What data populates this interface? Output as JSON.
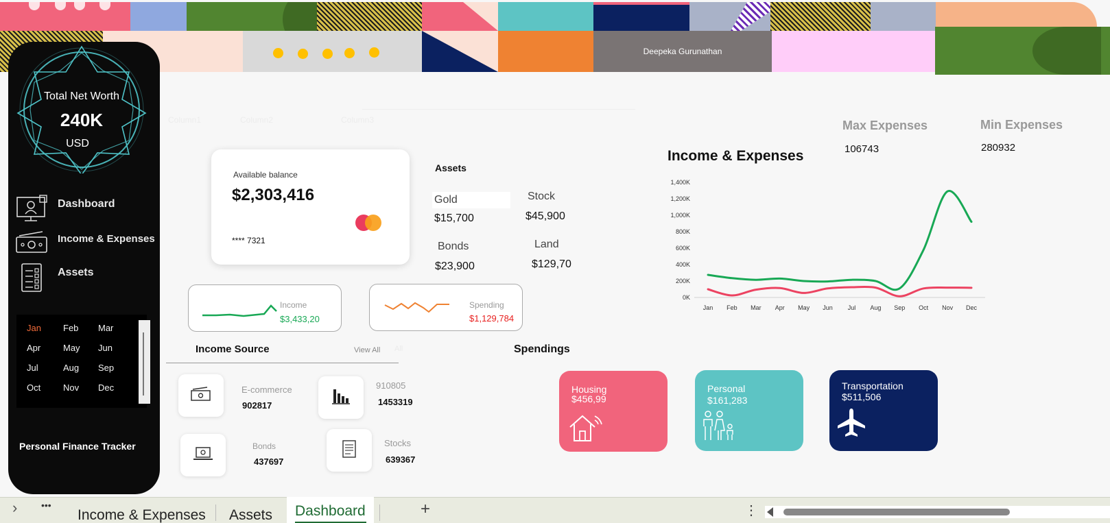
{
  "header": {
    "owner_name": "Deepeka Gurunathan"
  },
  "sidebar": {
    "networth": {
      "title": "Total Net Worth",
      "value": "240K",
      "unit": "USD"
    },
    "nav": [
      {
        "label": "Dashboard",
        "icon": "dashboard-monitor-icon"
      },
      {
        "label": "Income & Expenses",
        "icon": "cash-icon"
      },
      {
        "label": "Assets",
        "icon": "checklist-icon"
      }
    ],
    "months": [
      "Jan",
      "Feb",
      "Mar",
      "Apr",
      "May",
      "Jun",
      "Jul",
      "Aug",
      "Sep",
      "Oct",
      "Nov",
      "Dec"
    ],
    "selected_month": "Jan",
    "footer": "Personal Finance Tracker"
  },
  "faded_columns": [
    "Column1",
    "Column2",
    "Column3"
  ],
  "balance_card": {
    "label": "Available balance",
    "amount": "$2,303,416",
    "card_number": "**** 7321"
  },
  "assets": {
    "title": "Assets",
    "items": [
      {
        "name": "Gold",
        "value": "$15,700"
      },
      {
        "name": "Stock",
        "value": "$45,900"
      },
      {
        "name": "Bonds",
        "value": "$23,900"
      },
      {
        "name": "Land",
        "value": "$129,70"
      }
    ]
  },
  "income_mini": {
    "label": "Income",
    "value": "$3,433,20",
    "color": "#18a855"
  },
  "spending_mini": {
    "label": "Spending",
    "value": "$1,129,784",
    "color": "#e8201f"
  },
  "income_source": {
    "title": "Income Source",
    "view_all": "View All",
    "view_all_ghost": "All",
    "items": [
      {
        "name": "E-commerce",
        "value": "902817",
        "icon": "money-icon"
      },
      {
        "name": "910805",
        "value": "1453319",
        "icon": "bar-chart-icon"
      },
      {
        "name": "Bonds",
        "value": "437697",
        "icon": "laptop-icon"
      },
      {
        "name": "Stocks",
        "value": "639367",
        "icon": "document-icon"
      }
    ]
  },
  "spendings": {
    "title": "Spendings",
    "items": [
      {
        "name": "Housing",
        "value": "$456,99",
        "color": "#f1647c",
        "icon": "house-icon"
      },
      {
        "name": "Personal",
        "value": "$161,283",
        "color": "#5dc4c4",
        "icon": "family-icon"
      },
      {
        "name": "Transportation",
        "value": "$511,506",
        "color": "#0b2160",
        "icon": "airplane-icon"
      }
    ]
  },
  "kpis": {
    "max_label": "Max Expenses",
    "max_value": "106743",
    "min_label": "Min Expenses",
    "min_value": "280932"
  },
  "chart_data": {
    "type": "line",
    "title": "Income & Expenses",
    "categories": [
      "Jan",
      "Feb",
      "Mar",
      "Apr",
      "May",
      "Jun",
      "Jul",
      "Aug",
      "Sep",
      "Oct",
      "Nov",
      "Dec"
    ],
    "series": [
      {
        "color": "#18a855",
        "values": [
          275,
          235,
          215,
          230,
          200,
          195,
          215,
          200,
          110,
          580,
          1290,
          920
        ]
      },
      {
        "color": "#ec4361",
        "values": [
          100,
          25,
          95,
          115,
          55,
          110,
          125,
          120,
          15,
          110,
          120,
          118
        ]
      }
    ],
    "ylim": [
      0,
      1400
    ],
    "yticks": [
      "0K",
      "200K",
      "400K",
      "600K",
      "800K",
      "1,000K",
      "1,200K",
      "1,400K"
    ],
    "grid": false,
    "legend": "none"
  },
  "tabs": {
    "items": [
      "Income & Expenses",
      "Assets",
      "Dashboard"
    ],
    "active": "Dashboard",
    "add": "+",
    "more": "•••",
    "prev": "›",
    "menu": "⋮"
  }
}
